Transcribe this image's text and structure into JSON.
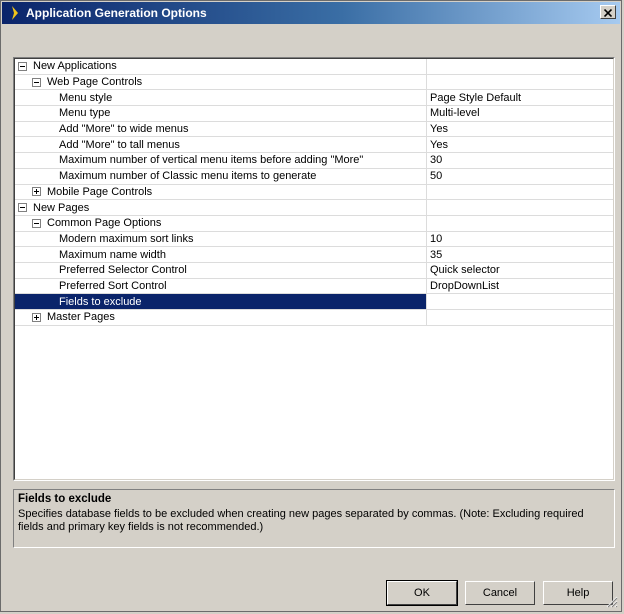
{
  "window": {
    "title": "Application Generation Options",
    "close_symbol": "×"
  },
  "grid": {
    "rows": [
      {
        "type": "category",
        "level": 0,
        "state": "expanded",
        "name": "New Applications",
        "value": ""
      },
      {
        "type": "category",
        "level": 1,
        "state": "expanded",
        "name": "Web Page Controls",
        "value": ""
      },
      {
        "type": "property",
        "name": "Menu style",
        "value": "Page Style Default"
      },
      {
        "type": "property",
        "name": "Menu type",
        "value": "Multi-level"
      },
      {
        "type": "property",
        "name": "Add \"More\" to wide menus",
        "value": "Yes"
      },
      {
        "type": "property",
        "name": "Add \"More\" to tall menus",
        "value": "Yes"
      },
      {
        "type": "property",
        "name": "Maximum number of vertical menu items before adding \"More\"",
        "value": "30"
      },
      {
        "type": "property",
        "name": "Maximum number of Classic menu items to generate",
        "value": "50"
      },
      {
        "type": "category",
        "level": 1,
        "state": "collapsed",
        "name": "Mobile Page Controls",
        "value": ""
      },
      {
        "type": "category",
        "level": 0,
        "state": "expanded",
        "name": "New Pages",
        "value": ""
      },
      {
        "type": "category",
        "level": 1,
        "state": "expanded",
        "name": "Common Page Options",
        "value": ""
      },
      {
        "type": "property",
        "name": "Modern maximum sort links",
        "value": "10"
      },
      {
        "type": "property",
        "name": "Maximum name width",
        "value": "35"
      },
      {
        "type": "property",
        "name": "Preferred Selector Control",
        "value": "Quick selector"
      },
      {
        "type": "property",
        "name": "Preferred Sort Control",
        "value": "DropDownList"
      },
      {
        "type": "property",
        "name": "Fields to exclude",
        "value": "",
        "selected": true
      },
      {
        "type": "category",
        "level": 1,
        "state": "collapsed",
        "name": "Master Pages",
        "value": ""
      }
    ]
  },
  "description": {
    "title": "Fields to exclude",
    "text": "Specifies database fields to be excluded when creating new pages separated by commas. (Note: Excluding required fields and primary key fields is not recommended.)"
  },
  "buttons": {
    "ok": "OK",
    "cancel": "Cancel",
    "help": "Help"
  },
  "colors": {
    "selection": "#0a246a",
    "title_start": "#0a246a",
    "title_end": "#a6caf0",
    "face": "#d4d0c8"
  }
}
